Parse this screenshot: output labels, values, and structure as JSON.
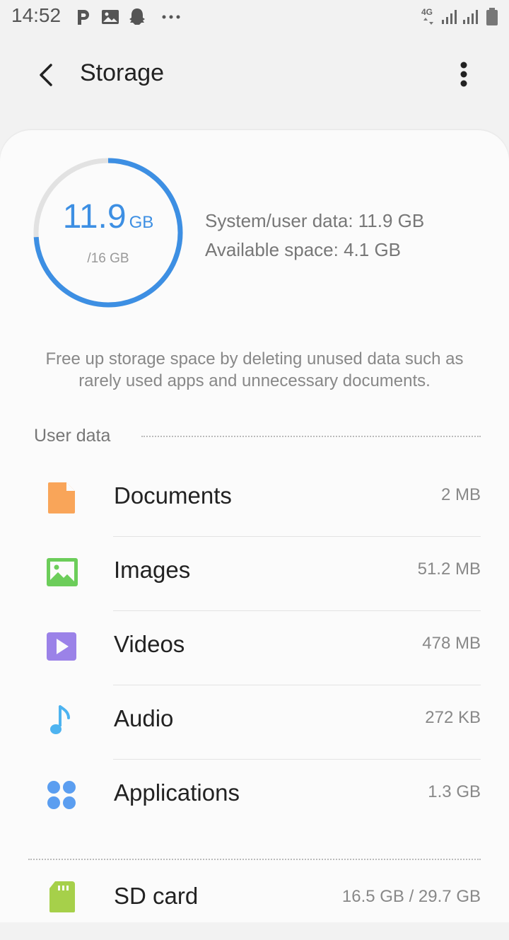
{
  "status_bar": {
    "time": "14:52",
    "network": "4G",
    "icons": [
      "p-icon",
      "image-icon",
      "ghost-icon",
      "more-dots-icon",
      "signal-icon",
      "signal-icon",
      "battery-icon"
    ]
  },
  "app_bar": {
    "title": "Storage",
    "back_icon": "chevron-left-icon",
    "menu_icon": "more-vertical-icon"
  },
  "summary": {
    "used_value": "11.9",
    "used_unit": "GB",
    "total": "/16 GB",
    "used_fraction": 0.74,
    "system_user_data": "System/user data: 11.9 GB",
    "available_space": "Available space: 4.1 GB",
    "accent_color": "#3d8fe3"
  },
  "hint": "Free up storage space by deleting unused data such as rarely used apps and unnecessary documents.",
  "user_data": {
    "header": "User data",
    "items": [
      {
        "label": "Documents",
        "value": "2 MB",
        "icon": "document-icon",
        "color": "#f9a559"
      },
      {
        "label": "Images",
        "value": "51.2 MB",
        "icon": "image-icon",
        "color": "#6ccd5a"
      },
      {
        "label": "Videos",
        "value": "478 MB",
        "icon": "video-icon",
        "color": "#9b82e8"
      },
      {
        "label": "Audio",
        "value": "272 KB",
        "icon": "music-note-icon",
        "color": "#4db3f0"
      },
      {
        "label": "Applications",
        "value": "1.3 GB",
        "icon": "apps-icon",
        "color": "#5b9ef0"
      }
    ]
  },
  "sd_card": {
    "label": "SD card",
    "value": "16.5 GB / 29.7 GB",
    "icon": "sd-card-icon",
    "color": "#a6d04a"
  }
}
